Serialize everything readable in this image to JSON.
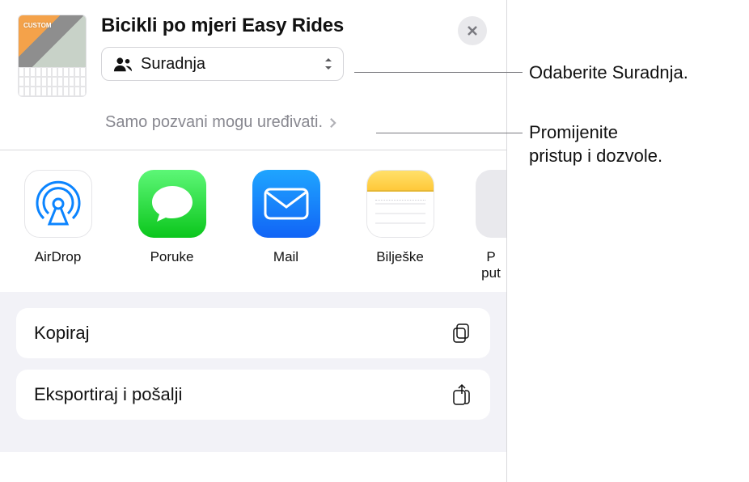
{
  "header": {
    "title": "Bicikli po mjeri Easy Rides",
    "thumb_badge": "CUSTOM",
    "dropdown": {
      "label": "Suradnja"
    },
    "permissions_text": "Samo pozvani mogu uređivati."
  },
  "apps": {
    "airdrop": "AirDrop",
    "messages": "Poruke",
    "mail": "Mail",
    "notes": "Bilješke",
    "more": "P\nput"
  },
  "actions": {
    "copy": "Kopiraj",
    "export": "Eksportiraj i pošalji"
  },
  "callouts": {
    "c1": "Odaberite Suradnja.",
    "c2": "Promijenite\npristup i dozvole."
  }
}
